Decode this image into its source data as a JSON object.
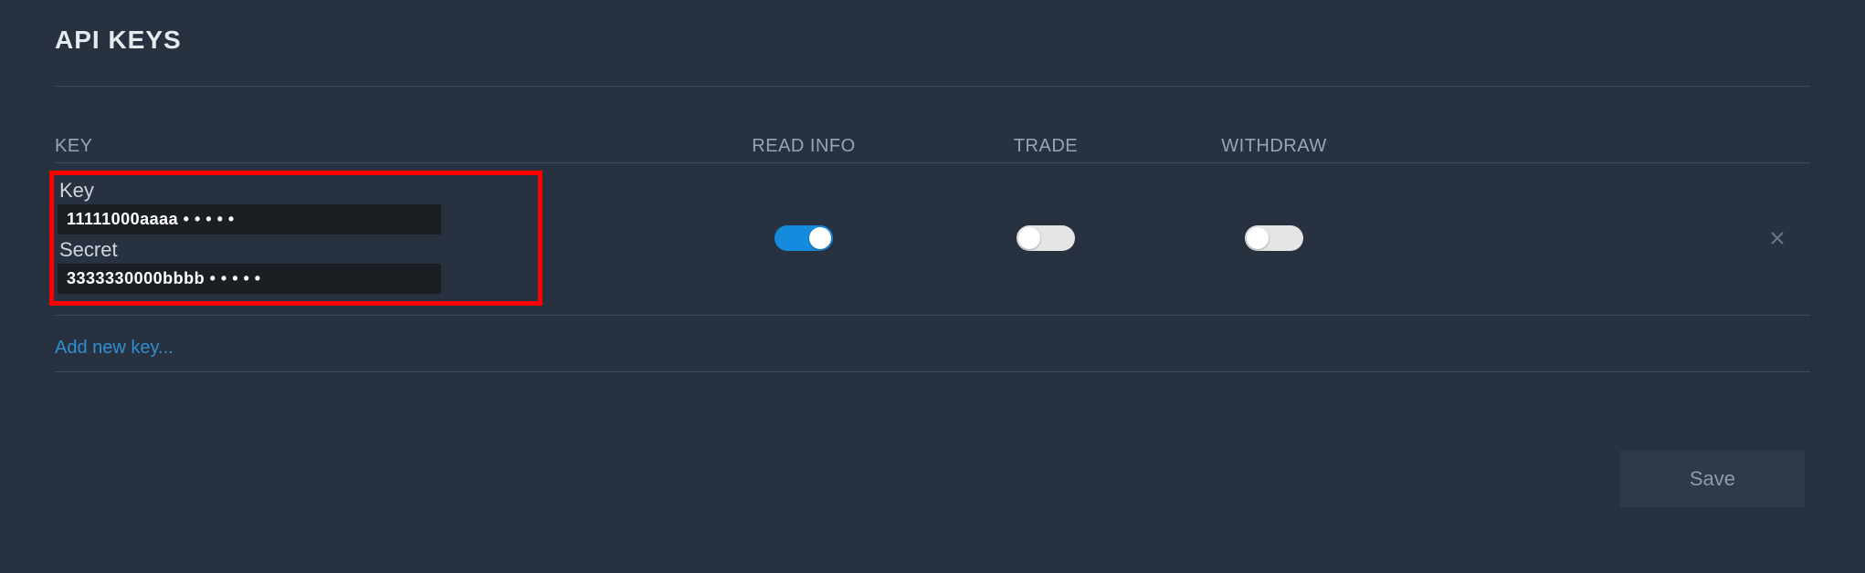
{
  "title": "API KEYS",
  "columns": {
    "key": "KEY",
    "read": "READ INFO",
    "trade": "TRADE",
    "withdraw": "WITHDRAW"
  },
  "row": {
    "key_label": "Key",
    "key_value": "11111000aaaa • • • • •",
    "secret_label": "Secret",
    "secret_value": "3333330000bbbb • • • • •",
    "read_on": true,
    "trade_on": false,
    "withdraw_on": false
  },
  "add_link": "Add new key...",
  "save_label": "Save"
}
